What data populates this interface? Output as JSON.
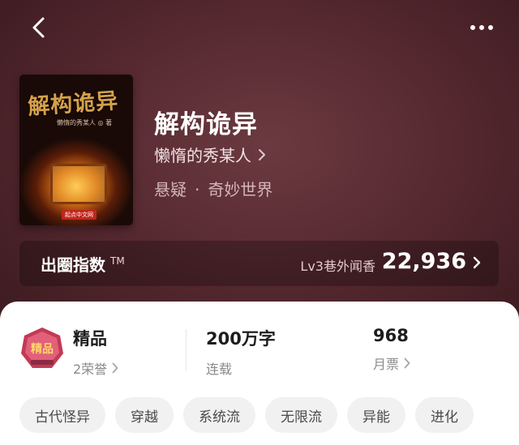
{
  "book": {
    "cover_title": "解构诡异",
    "cover_author": "懒惰的秀某人 ◎ 著",
    "cover_publisher": "起点中文网",
    "title": "解构诡异",
    "author": "懒惰的秀某人",
    "genre_main": "悬疑",
    "genre_separator": "·",
    "genre_sub": "奇妙世界"
  },
  "popularity": {
    "label": "出圈指数",
    "trademark": "TM",
    "level": "Lv3巷外闻香",
    "score": "22,936"
  },
  "stats": {
    "badge_text": "精品",
    "quality_label": "精品",
    "honors": "2荣誉",
    "word_count": "200万字",
    "status": "连载",
    "monthly_votes": "968",
    "monthly_votes_label": "月票"
  },
  "tags": [
    "古代怪异",
    "穿越",
    "系统流",
    "无限流",
    "异能",
    "进化"
  ],
  "icons": {
    "back": "chevron-left-icon",
    "more": "more-dots-icon",
    "chevron": "chevron-right-icon"
  },
  "colors": {
    "hero_bg": "#55282f",
    "card_bg": "#ffffff",
    "tag_bg": "#f1f1f1",
    "badge_red": "#c23a56"
  }
}
